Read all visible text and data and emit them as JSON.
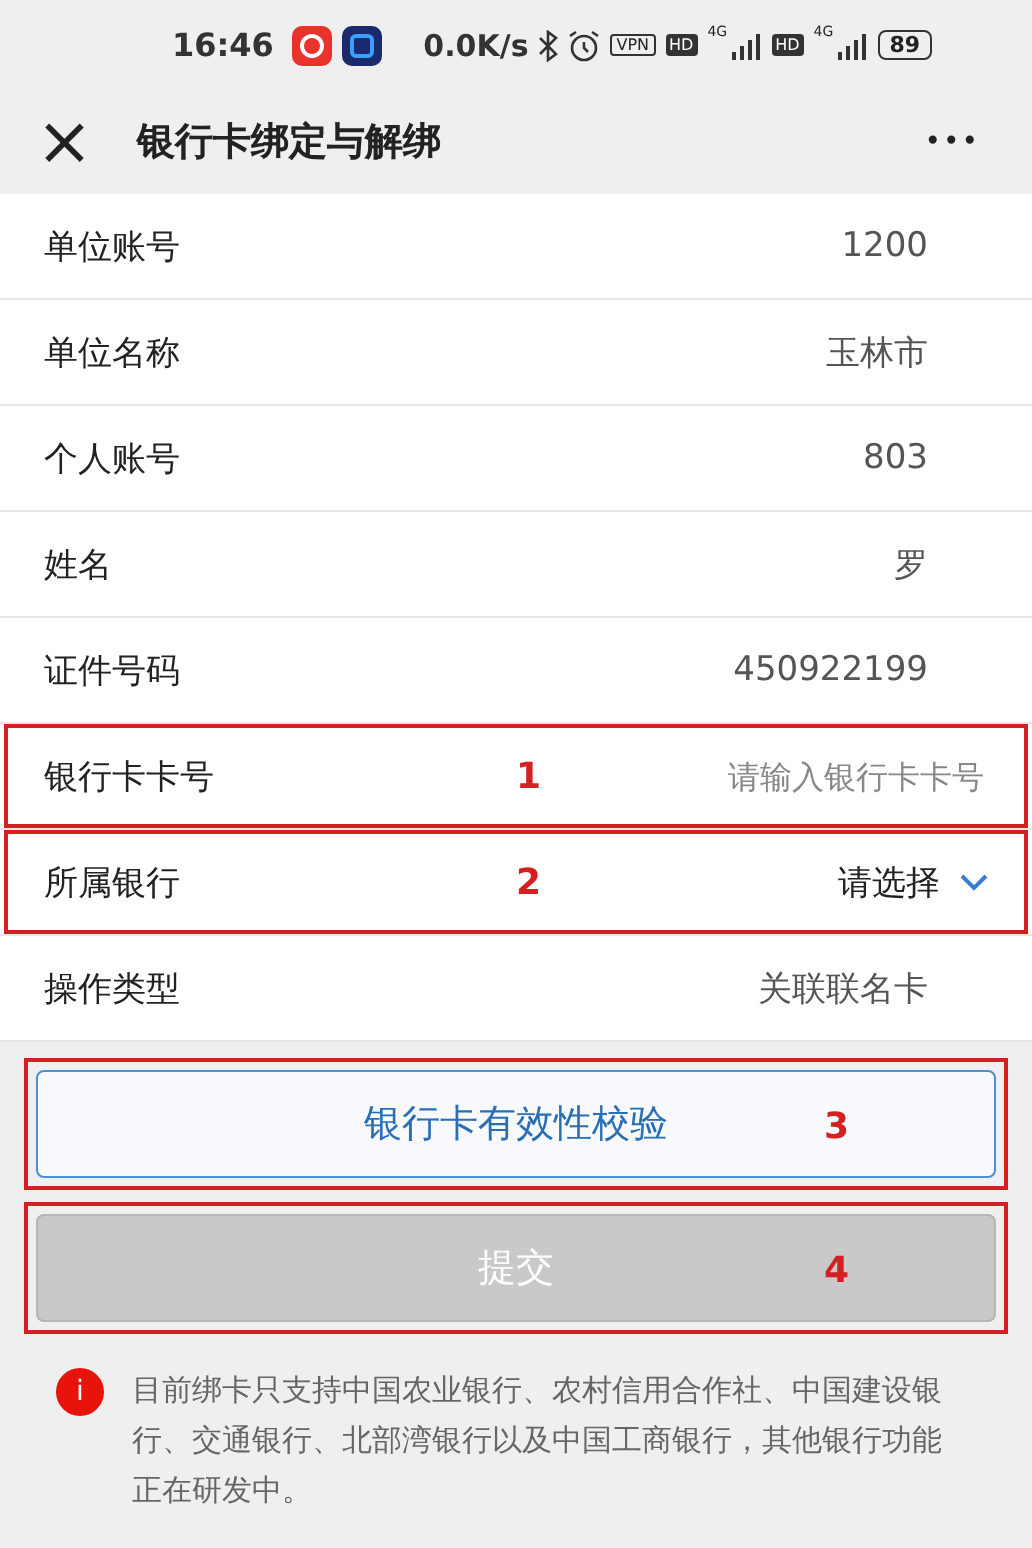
{
  "status_bar": {
    "time": "16:46",
    "speed": "0.0K/s",
    "vpn": "VPN",
    "hd_1": "HD",
    "net_1": "4G",
    "hd_2": "HD",
    "net_2": "4G",
    "battery": "89"
  },
  "header": {
    "close": "×",
    "title": "银行卡绑定与解绑",
    "more": "•••"
  },
  "fields": [
    {
      "kind": "display",
      "label": "单位账号",
      "value": "1200"
    },
    {
      "kind": "display",
      "label": "单位名称",
      "value": "玉林市"
    },
    {
      "kind": "display",
      "label": "个人账号",
      "value": "803"
    },
    {
      "kind": "display",
      "label": "姓名",
      "value": "罗"
    },
    {
      "kind": "display",
      "label": "证件号码",
      "value": "450922199"
    },
    {
      "kind": "input",
      "label": "银行卡卡号",
      "placeholder": "请输入银行卡卡号",
      "annotation": "1"
    },
    {
      "kind": "select",
      "label": "所属银行",
      "value": "请选择",
      "annotation": "2"
    },
    {
      "kind": "display",
      "label": "操作类型",
      "value": "关联联名卡"
    }
  ],
  "buttons": [
    {
      "label": "银行卡有效性校验",
      "disabled": false,
      "annotation": "3"
    },
    {
      "label": "提交",
      "disabled": true,
      "annotation": "4"
    }
  ],
  "notice": {
    "icon": "i",
    "text": "目前绑卡只支持中国农业银行、农村信用合作社、中国建设银行、交通银行、北部湾银行以及中国工商银行，其他银行功能正在研发中。"
  }
}
